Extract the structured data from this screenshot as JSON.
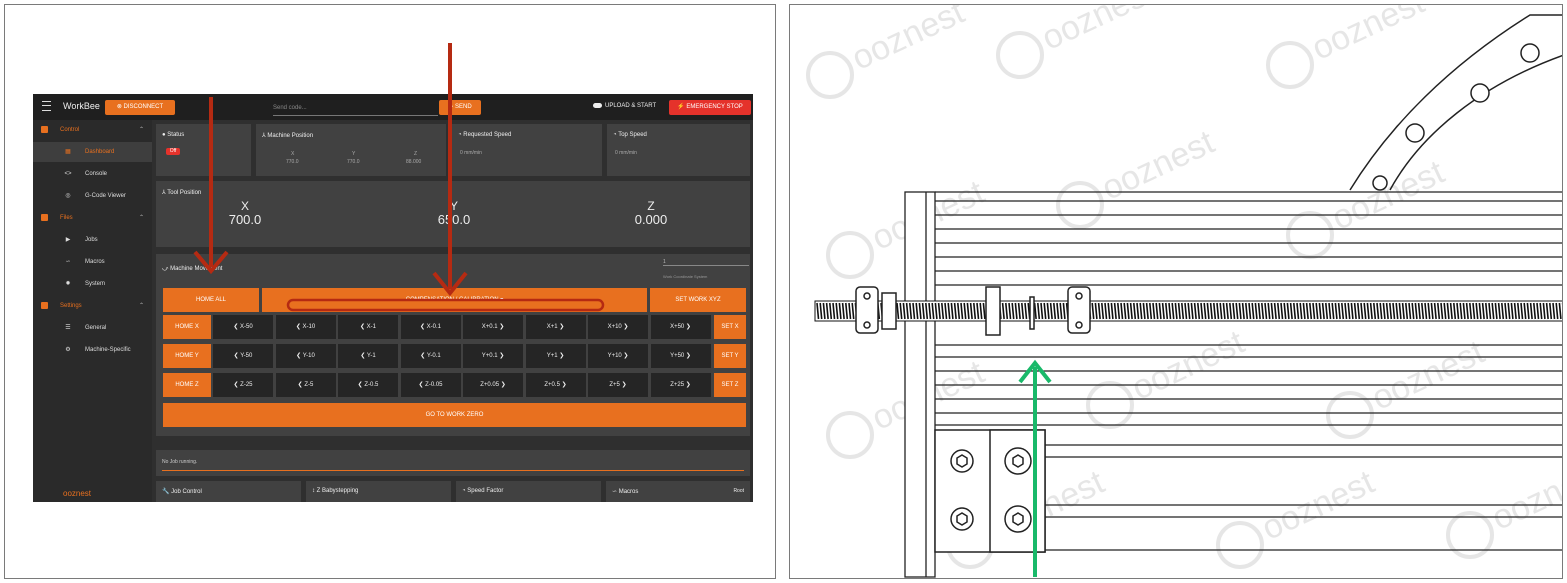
{
  "header": {
    "app_title": "WorkBee",
    "disconnect": "DISCONNECT",
    "send_placeholder": "Send code...",
    "send": "SEND",
    "upload": "UPLOAD & START",
    "estop": "EMERGENCY STOP"
  },
  "sidebar": {
    "control": "Control",
    "dashboard": "Dashboard",
    "console": "Console",
    "gcode_viewer": "G-Code Viewer",
    "files": "Files",
    "jobs": "Jobs",
    "macros": "Macros",
    "system": "System",
    "settings": "Settings",
    "general": "General",
    "machine_specific": "Machine-Specific",
    "logo": "ooznest"
  },
  "status": {
    "title": "Status",
    "badge": "Off"
  },
  "machine_position": {
    "title": "Machine Position",
    "x_label": "X",
    "x": "770.0",
    "y_label": "Y",
    "y": "770.0",
    "z_label": "Z",
    "z": "88.000"
  },
  "requested_speed": {
    "title": "Requested Speed",
    "value": "0 mm/min"
  },
  "top_speed": {
    "title": "Top Speed",
    "value": "0 mm/min"
  },
  "tool_position": {
    "title": "Tool Position",
    "x_label": "X",
    "x": "700.0",
    "y_label": "Y",
    "y": "650.0",
    "z_label": "Z",
    "z": "0.000"
  },
  "machine_movement": {
    "title": "Machine Movement",
    "wcs_value": "1",
    "wcs_caption": "Work Coordinate System",
    "home_all": "HOME ALL",
    "compensation": "COMPENSATION / CALIBRATION ▾",
    "set_work_xyz": "SET WORK XYZ",
    "rows": [
      {
        "home": "HOME X",
        "set": "SET X",
        "steps": [
          "❮ X-50",
          "❮ X-10",
          "❮ X-1",
          "❮ X-0.1",
          "X+0.1 ❯",
          "X+1 ❯",
          "X+10 ❯",
          "X+50 ❯"
        ]
      },
      {
        "home": "HOME Y",
        "set": "SET Y",
        "steps": [
          "❮ Y-50",
          "❮ Y-10",
          "❮ Y-1",
          "❮ Y-0.1",
          "Y+0.1 ❯",
          "Y+1 ❯",
          "Y+10 ❯",
          "Y+50 ❯"
        ]
      },
      {
        "home": "HOME Z",
        "set": "SET Z",
        "steps": [
          "❮ Z-25",
          "❮ Z-5",
          "❮ Z-0.5",
          "❮ Z-0.05",
          "Z+0.05 ❯",
          "Z+0.5 ❯",
          "Z+5 ❯",
          "Z+25 ❯"
        ]
      }
    ],
    "go_to_work_zero": "GO TO WORK ZERO"
  },
  "job": {
    "status": "No Job running."
  },
  "bottom_cards": {
    "job_control": "Job Control",
    "z_babystepping": "Z Babystepping",
    "speed_factor": "Speed Factor",
    "macros": "Macros",
    "root": "Root"
  },
  "watermark": "ooznest",
  "colors": {
    "orange": "#e8701f",
    "red_arrow": "#b52a12",
    "green_arrow": "#19b96a",
    "estop": "#e5322b"
  }
}
